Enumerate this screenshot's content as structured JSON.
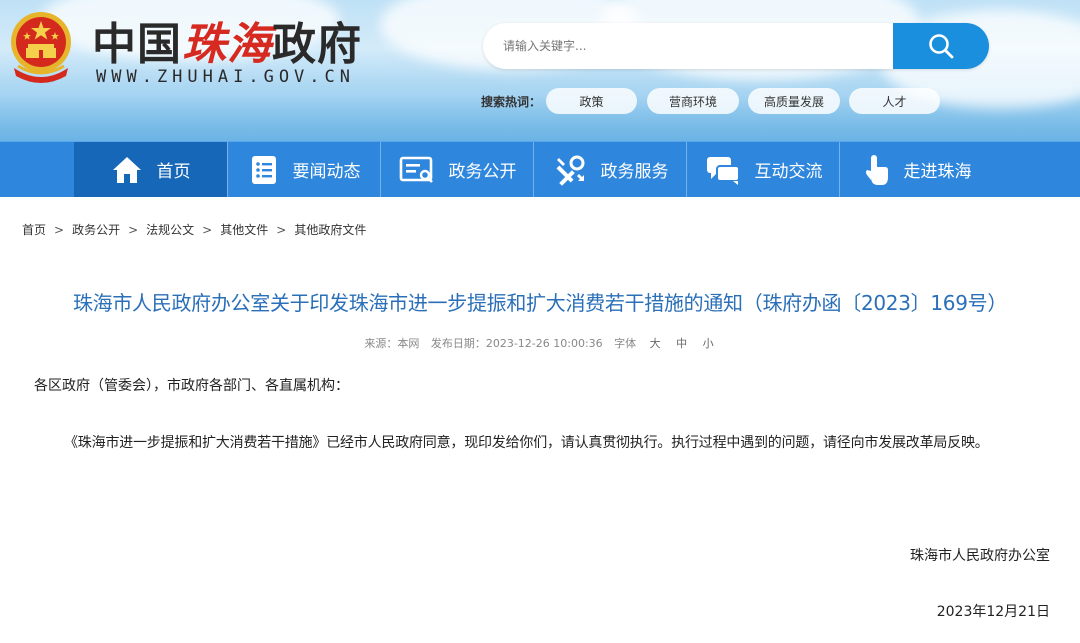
{
  "header": {
    "site_name_part1": "中国",
    "site_name_part2": "珠海",
    "site_name_part3": "政府",
    "site_url": "WWW.ZHUHAI.GOV.CN",
    "search_placeholder": "请输入关键字...",
    "hot_label": "搜索热词：",
    "hot_tags": [
      "政策",
      "营商环境",
      "高质量发展",
      "人才"
    ]
  },
  "nav": {
    "items": [
      {
        "label": "首页",
        "icon": "home-icon"
      },
      {
        "label": "要闻动态",
        "icon": "news-list-icon"
      },
      {
        "label": "政务公开",
        "icon": "document-icon"
      },
      {
        "label": "政务服务",
        "icon": "tools-icon"
      },
      {
        "label": "互动交流",
        "icon": "chat-icon"
      },
      {
        "label": "走进珠海",
        "icon": "pointer-hand-icon"
      }
    ]
  },
  "breadcrumb": [
    "首页",
    "政务公开",
    "法规公文",
    "其他文件",
    "其他政府文件"
  ],
  "article": {
    "title": "珠海市人民政府办公室关于印发珠海市进一步提振和扩大消费若干措施的通知（珠府办函〔2023〕169号）",
    "source": "来源：本网",
    "published": "发布日期：2023-12-26 10:00:36",
    "font_label": "字体",
    "font_large": "大",
    "font_medium": "中",
    "font_small": "小",
    "salutation": "各区政府（管委会），市政府各部门、各直属机构：",
    "body": "《珠海市进一步提振和扩大消费若干措施》已经市人民政府同意，现印发给你们，请认真贯彻执行。执行过程中遇到的问题，请径向市发展改革局反映。",
    "signature": "珠海市人民政府办公室",
    "date": "2023年12月21日"
  },
  "colors": {
    "nav_bg": "#2f87dd",
    "nav_active": "#1667b8",
    "title": "#2a6fb8",
    "search_button": "#1a8fde",
    "brand_red": "#d62a20"
  }
}
